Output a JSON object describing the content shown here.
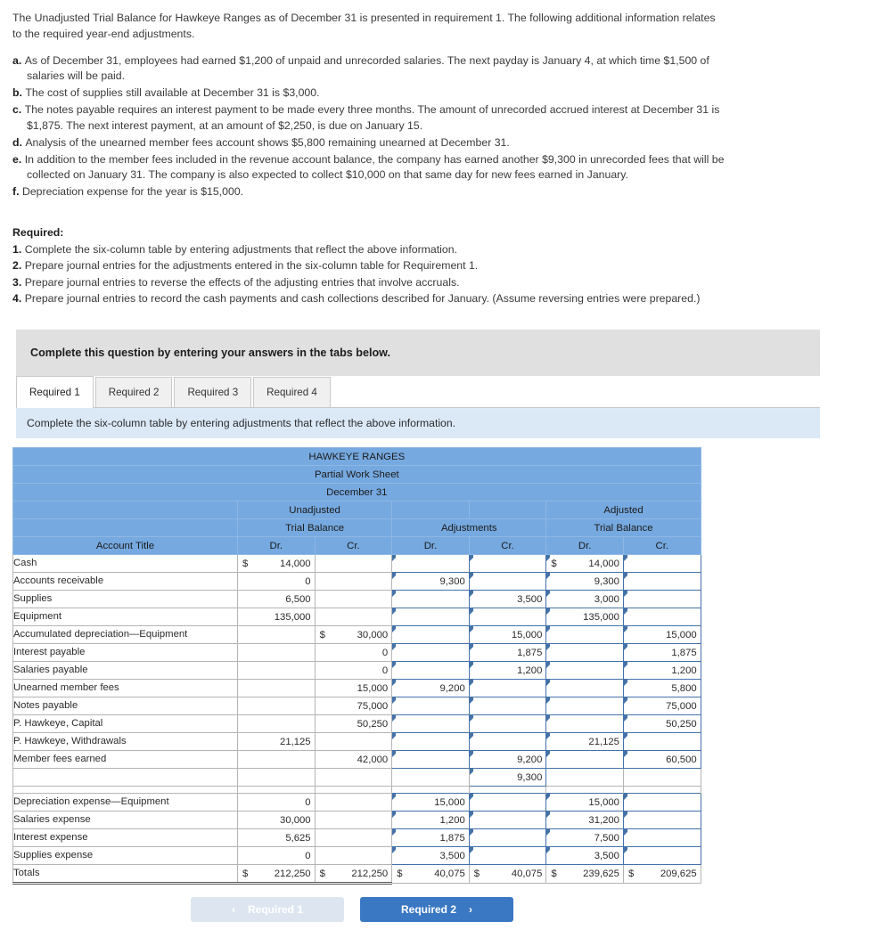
{
  "intro": {
    "paragraph": "The Unadjusted Trial Balance for Hawkeye Ranges as of December 31 is presented in requirement 1. The following additional information relates to the required year-end adjustments."
  },
  "facts": [
    {
      "label": "a.",
      "text": "As of December 31, employees had earned $1,200 of unpaid and unrecorded salaries. The next payday is January 4, at which time $1,500 of salaries will be paid."
    },
    {
      "label": "b.",
      "text": "The cost of supplies still available at December 31 is $3,000."
    },
    {
      "label": "c.",
      "text": "The notes payable requires an interest payment to be made every three months. The amount of unrecorded accrued interest at December 31 is $1,875. The next interest payment, at an amount of $2,250, is due on January 15."
    },
    {
      "label": "d.",
      "text": "Analysis of the unearned member fees account shows $5,800 remaining unearned at December 31."
    },
    {
      "label": "e.",
      "text": "In addition to the member fees included in the revenue account balance, the company has earned another $9,300 in unrecorded fees that will be collected on January 31. The company is also expected to collect $10,000 on that same day for new fees earned in January."
    },
    {
      "label": "f.",
      "text": "Depreciation expense for the year is $15,000."
    }
  ],
  "required": {
    "title": "Required:",
    "items": [
      {
        "num": "1.",
        "text": "Complete the six-column table by entering adjustments that reflect the above information."
      },
      {
        "num": "2.",
        "text": "Prepare journal entries for the adjustments entered in the six-column table for Requirement 1."
      },
      {
        "num": "3.",
        "text": "Prepare journal entries to reverse the effects of the adjusting entries that involve accruals."
      },
      {
        "num": "4.",
        "text": "Prepare journal entries to record the cash payments and cash collections described for January. (Assume reversing entries were prepared.)"
      }
    ]
  },
  "gray_banner": "Complete this question by entering your answers in the tabs below.",
  "tabs": [
    {
      "label": "Required 1",
      "active": true
    },
    {
      "label": "Required 2",
      "active": false
    },
    {
      "label": "Required 3",
      "active": false
    },
    {
      "label": "Required 4",
      "active": false
    }
  ],
  "blue_banner": "Complete the six-column table by entering adjustments that reflect the above information.",
  "worksheet": {
    "title_lines": [
      "HAWKEYE RANGES",
      "Partial Work Sheet",
      "December 31"
    ],
    "group_headers_row1": [
      "",
      "Unadjusted",
      "",
      "",
      "Adjusted"
    ],
    "group_headers_row2": [
      "",
      "Trial Balance",
      "Adjustments",
      "Trial Balance"
    ],
    "column_headers": [
      "Account Title",
      "Dr.",
      "Cr.",
      "Dr.",
      "Cr.",
      "Dr.",
      "Cr."
    ],
    "rows": [
      {
        "title": "Cash",
        "utb_dr": "14,000",
        "utb_dr_sym": "$",
        "utb_cr": "",
        "adj_dr": "",
        "adj_cr": "",
        "atb_dr": "14,000",
        "atb_dr_sym": "$",
        "atb_cr": ""
      },
      {
        "title": "Accounts receivable",
        "utb_dr": "0",
        "utb_cr": "",
        "adj_dr": "9,300",
        "adj_cr": "",
        "atb_dr": "9,300",
        "atb_cr": ""
      },
      {
        "title": "Supplies",
        "utb_dr": "6,500",
        "utb_cr": "",
        "adj_dr": "",
        "adj_cr": "3,500",
        "atb_dr": "3,000",
        "atb_cr": ""
      },
      {
        "title": "Equipment",
        "utb_dr": "135,000",
        "utb_cr": "",
        "adj_dr": "",
        "adj_cr": "",
        "atb_dr": "135,000",
        "atb_cr": ""
      },
      {
        "title": "Accumulated depreciation—Equipment",
        "utb_dr": "",
        "utb_cr": "30,000",
        "utb_cr_sym": "$",
        "adj_dr": "",
        "adj_cr": "15,000",
        "atb_dr": "",
        "atb_cr": "15,000"
      },
      {
        "title": "Interest payable",
        "utb_dr": "",
        "utb_cr": "0",
        "adj_dr": "",
        "adj_cr": "1,875",
        "atb_dr": "",
        "atb_cr": "1,875"
      },
      {
        "title": "Salaries payable",
        "utb_dr": "",
        "utb_cr": "0",
        "adj_dr": "",
        "adj_cr": "1,200",
        "atb_dr": "",
        "atb_cr": "1,200"
      },
      {
        "title": "Unearned member fees",
        "utb_dr": "",
        "utb_cr": "15,000",
        "adj_dr": "9,200",
        "adj_cr": "",
        "atb_dr": "",
        "atb_cr": "5,800"
      },
      {
        "title": "Notes payable",
        "utb_dr": "",
        "utb_cr": "75,000",
        "adj_dr": "",
        "adj_cr": "",
        "atb_dr": "",
        "atb_cr": "75,000"
      },
      {
        "title": "P. Hawkeye, Capital",
        "utb_dr": "",
        "utb_cr": "50,250",
        "adj_dr": "",
        "adj_cr": "",
        "atb_dr": "",
        "atb_cr": "50,250"
      },
      {
        "title": "P. Hawkeye, Withdrawals",
        "utb_dr": "21,125",
        "utb_cr": "",
        "adj_dr": "",
        "adj_cr": "",
        "atb_dr": "21,125",
        "atb_cr": ""
      },
      {
        "title": "Member fees earned",
        "utb_dr": "",
        "utb_cr": "42,000",
        "adj_dr": "",
        "adj_cr": "9,200",
        "atb_dr": "",
        "atb_cr": "60,500"
      },
      {
        "title": "",
        "utb_dr": "",
        "utb_cr": "",
        "adj_dr": "",
        "adj_cr": "9,300",
        "atb_dr": "",
        "atb_cr": "",
        "only_adj_cr": true
      },
      {
        "title": "Depreciation expense—Equipment",
        "utb_dr": "0",
        "utb_cr": "",
        "adj_dr": "15,000",
        "adj_cr": "",
        "atb_dr": "15,000",
        "atb_cr": ""
      },
      {
        "title": "Salaries expense",
        "utb_dr": "30,000",
        "utb_cr": "",
        "adj_dr": "1,200",
        "adj_cr": "",
        "atb_dr": "31,200",
        "atb_cr": ""
      },
      {
        "title": "Interest expense",
        "utb_dr": "5,625",
        "utb_cr": "",
        "adj_dr": "1,875",
        "adj_cr": "",
        "atb_dr": "7,500",
        "atb_cr": ""
      },
      {
        "title": "Supplies expense",
        "utb_dr": "0",
        "utb_cr": "",
        "adj_dr": "3,500",
        "adj_cr": "",
        "atb_dr": "3,500",
        "atb_cr": ""
      }
    ],
    "totals": {
      "title": "Totals",
      "utb_dr": "212,250",
      "utb_cr": "212,250",
      "adj_dr": "40,075",
      "adj_cr": "40,075",
      "atb_dr": "239,625",
      "atb_cr": "209,625",
      "symbol": "$"
    }
  },
  "nav": {
    "prev_label": "Required 1",
    "next_label": "Required 2",
    "prev_chevron": "‹",
    "next_chevron": "›"
  },
  "colors": {
    "header_blue": "#76a9e0",
    "banner_blue": "#dbe9f7",
    "banner_gray": "#e0e0e0",
    "button_blue": "#3b78c3",
    "input_border": "#4472a8"
  }
}
